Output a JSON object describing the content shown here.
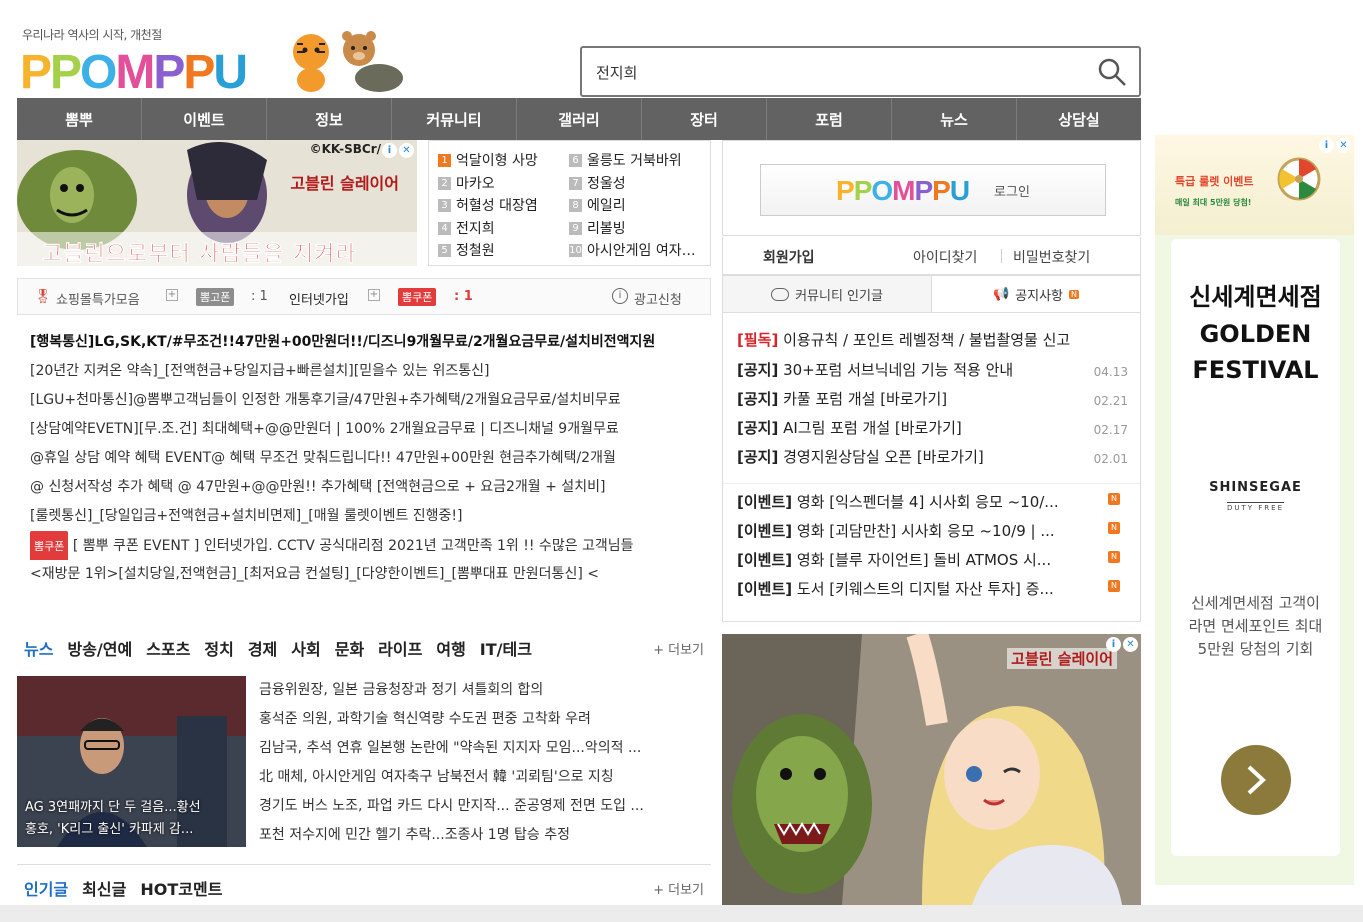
{
  "header": {
    "slogan": "우리나라 역사의 시작, 개천절",
    "logo_text": "PPOMPPU",
    "search_value": "전지희"
  },
  "nav": [
    "뽐뿌",
    "이벤트",
    "정보",
    "커뮤니티",
    "갤러리",
    "장터",
    "포럼",
    "뉴스",
    "상담실"
  ],
  "banner_left": {
    "copyright": "©KK-SBCr/",
    "title": "고블린 슬레이어",
    "tagline": "고블린으로부터 사람들을 지켜라"
  },
  "ranking": [
    {
      "n": "1",
      "t": "억달이형 사망"
    },
    {
      "n": "2",
      "t": "마카오"
    },
    {
      "n": "3",
      "t": "허혈성 대장염"
    },
    {
      "n": "4",
      "t": "전지희"
    },
    {
      "n": "5",
      "t": "정철원"
    },
    {
      "n": "6",
      "t": "울릉도 거북바위"
    },
    {
      "n": "7",
      "t": "정울성"
    },
    {
      "n": "8",
      "t": "에일리"
    },
    {
      "n": "9",
      "t": "리볼빙"
    },
    {
      "n": "10",
      "t": "아시안게임 여자축구"
    }
  ],
  "adrow": {
    "shop": "쇼핑몰특가모음",
    "chip1": "뽐고폰",
    "count1": ": 1",
    "internet": "인터넷가입",
    "chip2": "뽐쿠폰",
    "count2": ": 1",
    "apply": "광고신청"
  },
  "adlist": [
    "[행복통신]LG,SK,KT/#무조건!!47만원+00만원더!!/디즈니9개월무료/2개월요금무료/설치비전액지원",
    "[20년간 지켜온 약속]_[전액현금+당일지급+빠른설치][믿을수 있는 위즈통신]",
    "[LGU+천마통신]@뽐뿌고객님들이 인정한 개통후기글/47만원+추가혜택/2개월요금무료/설치비무료",
    "[상담예약EVETN][무.조.건] 최대혜택+@@만원더 | 100% 2개월요금무료 | 디즈니채널 9개월무료",
    "@휴일 상담 예약 혜택 EVENT@ 혜택 무조건 맞춰드립니다!! 47만원+00만원 현금추가혜택/2개월",
    "@ 신청서작성 추가 혜택 @ 47만원+@@만원!! 추가혜택 [전액현금으로 + 요금2개월 + 설치비]",
    "[룰렛통신]_[당일입금+전액현금+설치비면제]_[매월 룰렛이벤트 진행중!]",
    "[ 뽐뿌 쿠폰 EVENT ] 인터넷가입. CCTV 공식대리점 2021년 고객만족 1위 !! 수많은 고객님들",
    "<재방문 1위>[설치당일,전액현금]_[최저요금 컨설팅]_[다양한이벤트]_[뽐뿌대표 만원더통신] <"
  ],
  "adlist_chip": "뽐쿠폰",
  "login": {
    "logo": "PPOMPPU",
    "label": "로그인",
    "join": "회원가입",
    "find_id": "아이디찾기",
    "find_pw": "비밀번호찾기"
  },
  "tabs": {
    "community": "커뮤니티 인기글",
    "notice": "공지사항",
    "badge": "N"
  },
  "notices": [
    {
      "tag": "[필독]",
      "t": "이용규칙 / 포인트 레벨정책 / 불법촬영물 신고",
      "d": ""
    },
    {
      "tag": "[공지]",
      "t": "30+포럼 서브닉네임 기능 적용 안내",
      "d": "04.13"
    },
    {
      "tag": "[공지]",
      "t": "카풀 포럼 개설 [바로가기]",
      "d": "02.21"
    },
    {
      "tag": "[공지]",
      "t": "AI그림 포럼 개설 [바로가기]",
      "d": "02.17"
    },
    {
      "tag": "[공지]",
      "t": "경영지원상담실 오픈 [바로가기]",
      "d": "02.01"
    }
  ],
  "events": [
    {
      "tag": "[이벤트]",
      "t": "영화 [익스펜더블 4] 시사회 응모 ~10/..."
    },
    {
      "tag": "[이벤트]",
      "t": "영화 [괴담만찬] 시사회 응모 ~10/9 | ..."
    },
    {
      "tag": "[이벤트]",
      "t": "영화 [블루 자이언트] 돌비 ATMOS 시..."
    },
    {
      "tag": "[이벤트]",
      "t": "도서 [키웨스트의 디지털 자산 투자] 증..."
    }
  ],
  "news": {
    "tabs": [
      "뉴스",
      "방송/연예",
      "스포츠",
      "정치",
      "경제",
      "사회",
      "문화",
      "라이프",
      "여행",
      "IT/테크"
    ],
    "more": "+ 더보기",
    "img_caption_1": "AG 3연패까지 단 두 걸음...황선",
    "img_caption_2": "홍호, 'K리그 출신' 카파제 감...",
    "items": [
      "금융위원장, 일본 금융청장과 정기 셔틀회의 합의",
      "홍석준 의원, 과학기술 혁신역량 수도권 편중 고착화 우려",
      "김남국, 추석 연휴 일본행 논란에 \"약속된 지지자 모임...악의적 ...",
      "北 매체, 아시안게임 여자축구 남북전서 韓 '괴뢰팀'으로 지칭",
      "경기도 버스 노조, 파업 카드 다시 만지작... 준공영제 전면 도입 ...",
      "포천 저수지에 민간 헬기 추락...조종사 1명 탑승 추정"
    ]
  },
  "popular": {
    "tabs": [
      "인기글",
      "최신글",
      "HOT코멘트"
    ],
    "more": "+ 더보기"
  },
  "banner_right": {
    "title": "고블린 슬레이어"
  },
  "sky": {
    "head_title": "특급 룰렛 이벤트",
    "head_sub": "매일 최대 5만원 당첨!",
    "title1": "신세계면세점",
    "title2": "GOLDEN",
    "title3": "FESTIVAL",
    "brand": "SHINSEGAE",
    "brand_sub": "DUTY FREE",
    "desc": "신세계면세점 고객이라면 면세포인트 최대 5만원 당첨의 기회"
  },
  "colors": {
    "nav_bg": "#626262",
    "accent_red": "#e23b3b",
    "tab_blue": "#1f6fc4"
  }
}
